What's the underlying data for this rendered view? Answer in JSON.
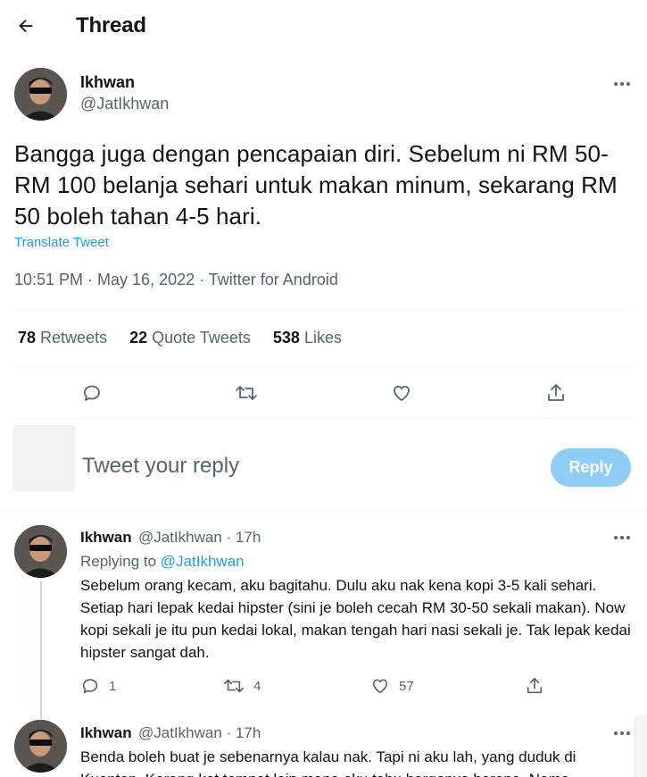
{
  "header": {
    "title": "Thread"
  },
  "main_tweet": {
    "name": "Ikhwan",
    "handle": "@JatIkhwan",
    "text": "Bangga juga dengan pencapaian diri. Sebelum ni RM 50-RM 100 belanja sehari untuk makan minum, sekarang RM 50 boleh tahan 4-5 hari.",
    "translate_label": "Translate Tweet",
    "timestamp": "10:51 PM · May 16, 2022 · Twitter for Android",
    "stats": [
      {
        "count": "78",
        "label": "Retweets"
      },
      {
        "count": "22",
        "label": "Quote Tweets"
      },
      {
        "count": "538",
        "label": "Likes"
      }
    ]
  },
  "icons": {
    "back": "arrow-left-icon",
    "more": "more-horizontal-icon",
    "reply": "reply-bubble-icon",
    "retweet": "retweet-icon",
    "like": "heart-icon",
    "share": "share-icon"
  },
  "composer": {
    "placeholder": "Tweet your reply",
    "button_label": "Reply"
  },
  "replies": [
    {
      "name": "Ikhwan",
      "handle_time": "@JatIkhwan · 17h",
      "replying_prefix": "Replying to",
      "replying_to": "@JatIkhwan",
      "text": "Sebelum orang kecam, aku bagitahu. Dulu aku nak kena kopi 3-5 kali sehari. Setiap hari lepak kedai hipster (sini je boleh cecah RM 30-50 sekali makan). Now kopi sekali je itu pun kedai lokal, makan tengah hari nasi sekali je. Tak lepak kedai hipster sangat dah.",
      "reply_count": "1",
      "retweet_count": "4",
      "like_count": "57"
    },
    {
      "name": "Ikhwan",
      "handle_time": "@JatIkhwan · 17h",
      "text": "Benda boleh buat je sebenarnya kalau nak. Tapi ni aku lah, yang duduk di Kuantan. Kerang kat tempat lain mana aku tahu harganya berapa. Nama"
    }
  ],
  "colors": {
    "accent": "#1d9bf0",
    "muted": "#536471",
    "text": "#0f1419",
    "reply_button_disabled": "#8ecdf8"
  }
}
